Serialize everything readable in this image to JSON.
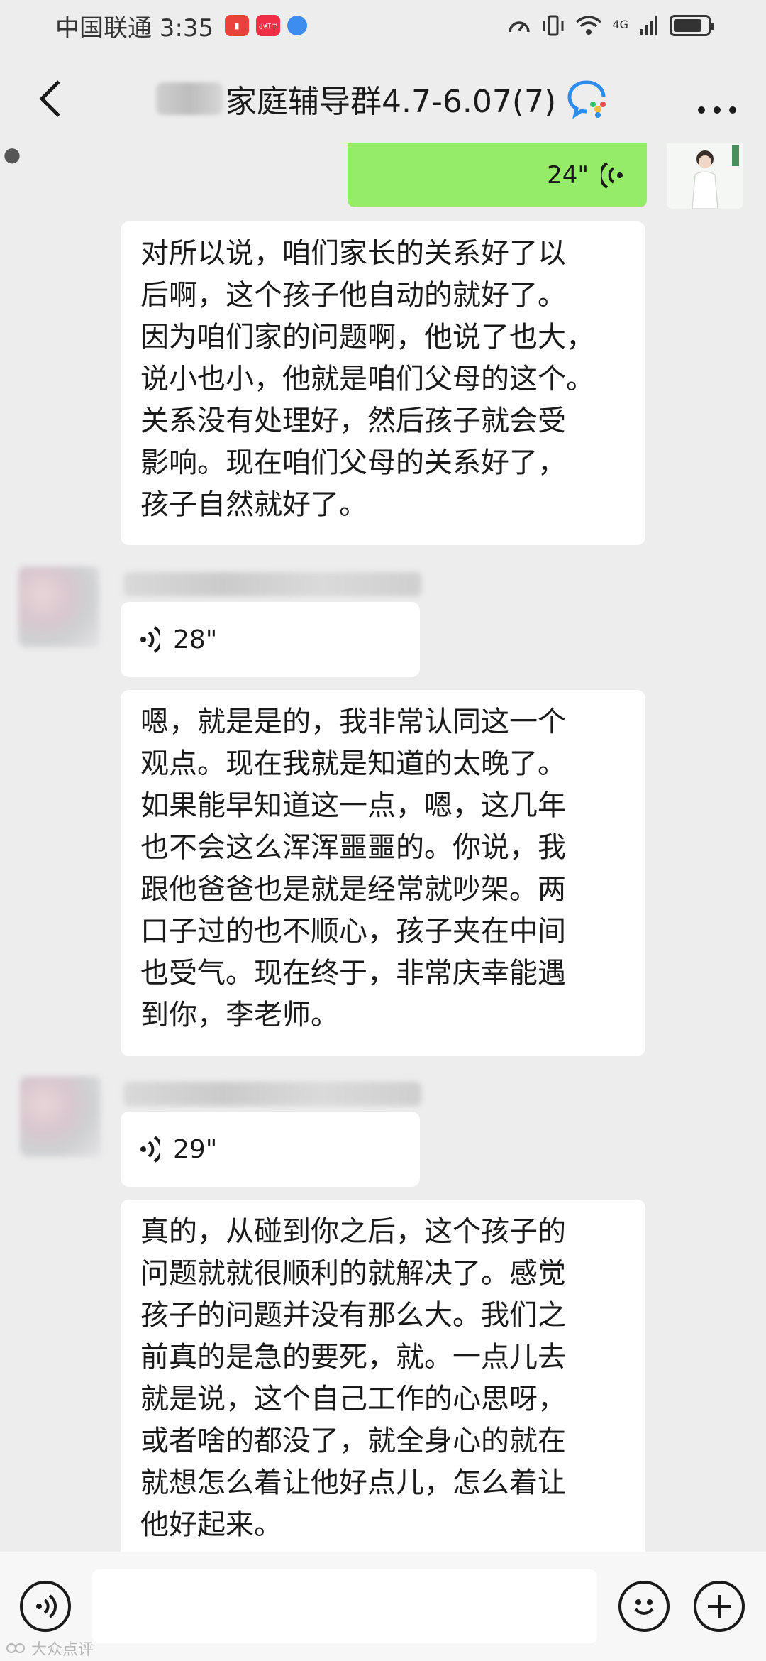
{
  "status_bar": {
    "carrier_time": "中国联通 3:35",
    "notification_apps": [
      "huawei-store-icon",
      "chat-bubble-icon",
      "xiaohongshu-icon",
      "browser-icon"
    ],
    "xiaohongshu_label": "小红书",
    "network": "4G",
    "battery_level": 0.85
  },
  "nav": {
    "title": "家庭辅导群4.7-6.07(7)"
  },
  "messages": [
    {
      "type": "voice",
      "direction": "out",
      "duration": "24\""
    },
    {
      "type": "text",
      "direction": "in",
      "text": "对所以说，咱们家长的关系好了以\n后啊，这个孩子他自动的就好了。\n因为咱们家的问题啊，他说了也大，\n说小也小，他就是咱们父母的这个。\n关系没有处理好，然后孩子就会受\n影响。现在咱们父母的关系好了，\n孩子自然就好了。"
    },
    {
      "type": "voice",
      "direction": "in",
      "duration": "28\""
    },
    {
      "type": "text",
      "direction": "in",
      "text": "嗯，就是是的，我非常认同这一个\n观点。现在我就是知道的太晚了。\n如果能早知道这一点，嗯，这几年\n也不会这么浑浑噩噩的。你说，我\n跟他爸爸也是就是经常就吵架。两\n口子过的也不顺心，孩子夹在中间\n也受气。现在终于，非常庆幸能遇\n到你，李老师。"
    },
    {
      "type": "voice",
      "direction": "in",
      "duration": "29\""
    },
    {
      "type": "text",
      "direction": "in",
      "text": "真的，从碰到你之后，这个孩子的\n问题就就很顺利的就解决了。感觉\n孩子的问题并没有那么大。我们之\n前真的是急的要死，就。一点儿去\n就是说，这个自己工作的心思呀，\n或者啥的都没了，就全身心的就在\n就想怎么着让他好点儿，怎么着让\n他好起来。"
    }
  ],
  "watermark": "大众点评",
  "colors": {
    "background": "#ededed",
    "outgoing_bubble": "#95ec69",
    "incoming_bubble": "#ffffff"
  }
}
